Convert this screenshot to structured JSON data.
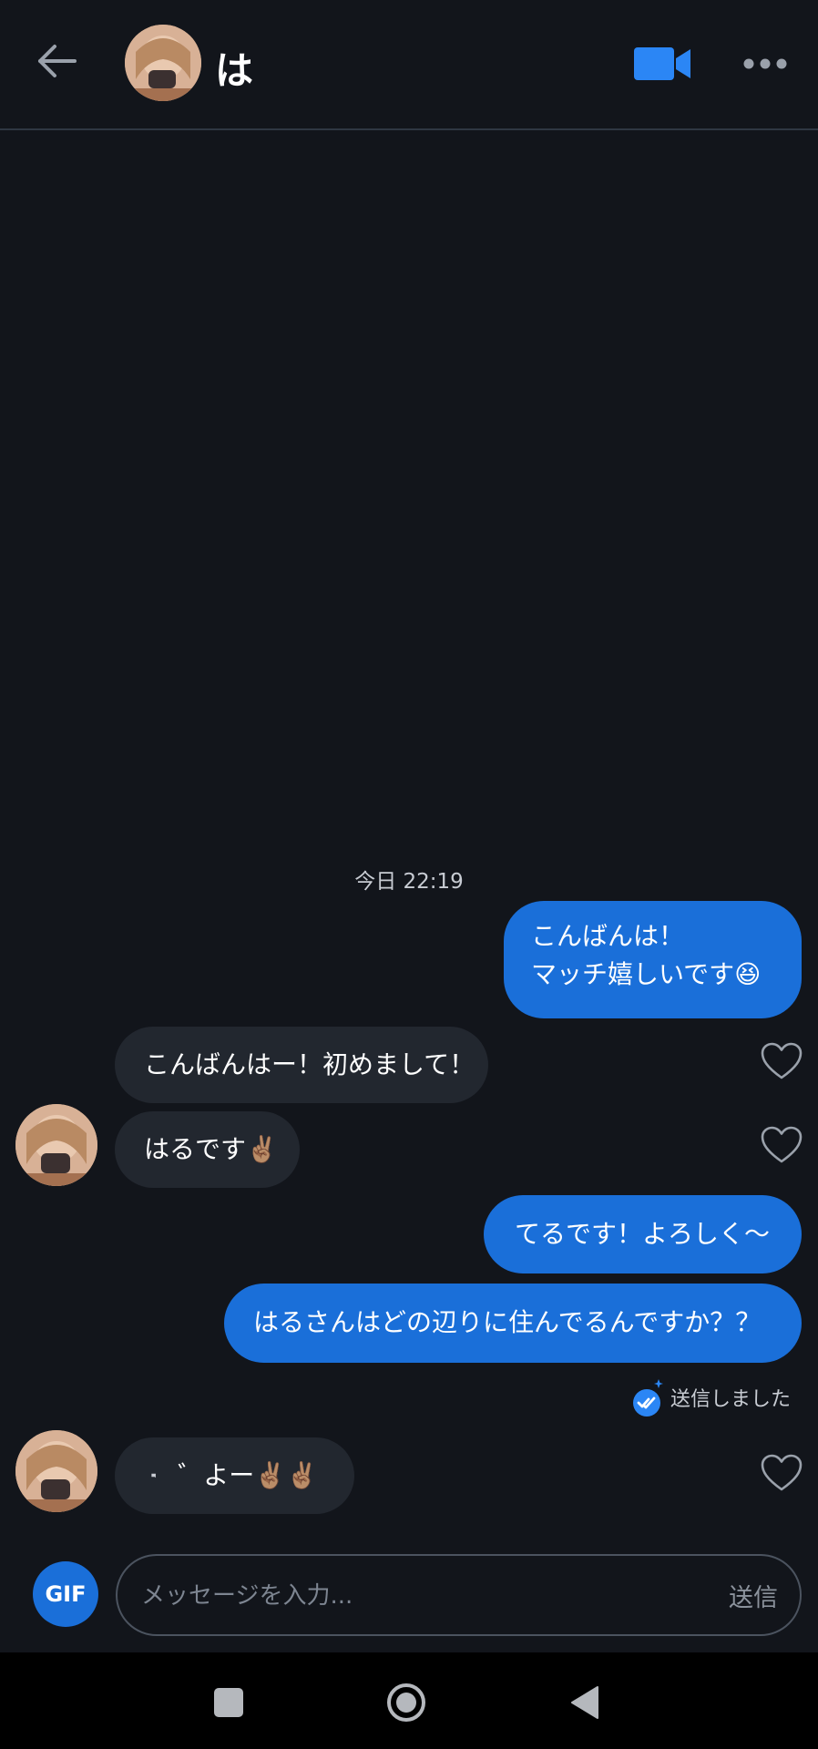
{
  "header": {
    "name": "は",
    "back_icon": "arrow-left-icon",
    "video_icon": "video-camera-icon",
    "more_icon": "more-dots-icon",
    "accent_color": "#2b86f5"
  },
  "conversation": {
    "timestamp": "今日 22:19",
    "messages": [
      {
        "direction": "out",
        "lines": [
          "こんばんは！",
          "マッチ嬉しいです😆"
        ]
      },
      {
        "direction": "in",
        "text": "こんばんはー！初めまして！"
      },
      {
        "direction": "in",
        "text": "はるです✌🏽"
      },
      {
        "direction": "out",
        "text": "てるです！よろしく〜"
      },
      {
        "direction": "out",
        "text": "はるさんはどの辺りに住んでるんですか？？"
      },
      {
        "direction": "in",
        "text": "゛よー✌🏽✌🏽"
      }
    ],
    "sent_status": "送信しました"
  },
  "composer": {
    "gif_label": "GIF",
    "placeholder": "メッセージを入力...",
    "send_label": "送信"
  },
  "colors": {
    "background": "#12151b",
    "outgoing_bubble": "#1a6fd9",
    "incoming_bubble": "#22272f"
  }
}
